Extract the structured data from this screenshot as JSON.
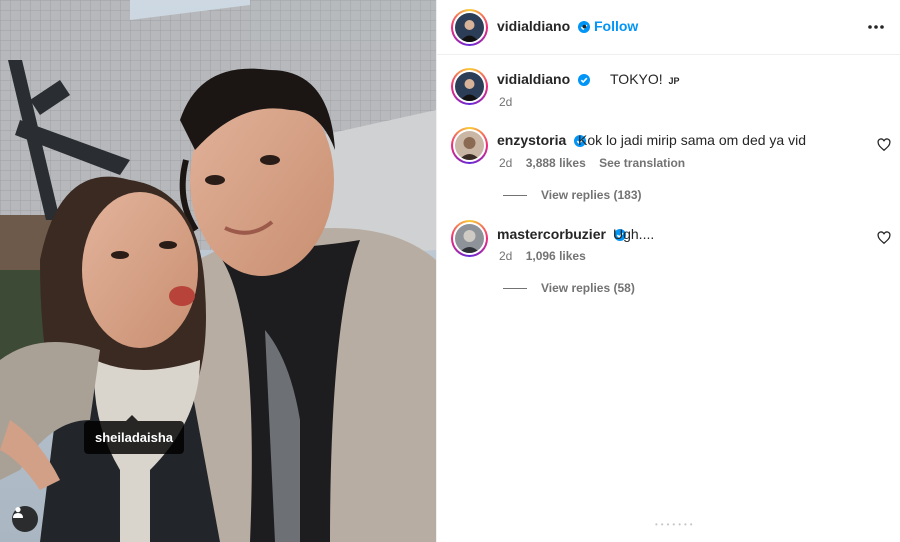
{
  "post": {
    "username": "vidialdiano",
    "follow_label": "Follow",
    "separator": "•",
    "more_icon": "more-horizontal-icon",
    "caption_text": "TOKYO!",
    "caption_flag": "JP",
    "caption_time": "2d",
    "photo_tag": "sheiladaisha"
  },
  "comments": [
    {
      "username": "enzystoria",
      "text": "Kok lo jadi mirip sama om ded ya vid",
      "time": "2d",
      "likes": "3,888 likes",
      "translate": "See translation",
      "replies": "View replies (183)"
    },
    {
      "username": "mastercorbuzier",
      "text": "Ugh....",
      "time": "2d",
      "likes": "1,096 likes",
      "replies": "View replies (58)"
    }
  ],
  "colors": {
    "accent": "#0095f6",
    "verified": "#0095f6",
    "muted": "#737373"
  }
}
